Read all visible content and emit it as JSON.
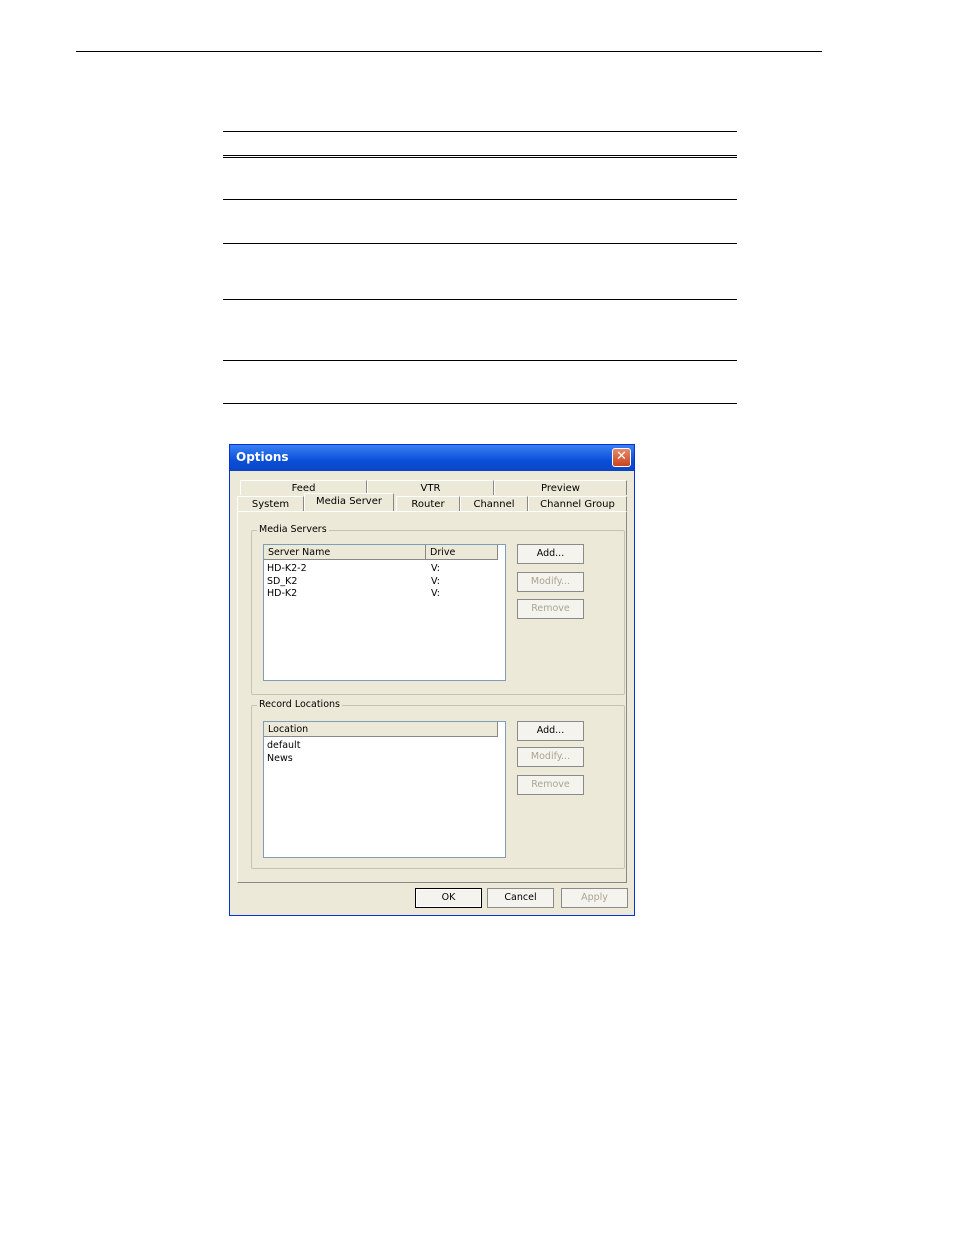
{
  "dialog": {
    "title": "Options",
    "close_glyph": "✕",
    "tabs_row1": [
      "Feed",
      "VTR",
      "Preview"
    ],
    "tabs_row2": [
      "System",
      "Media Server",
      "Router",
      "Channel",
      "Channel Group"
    ],
    "active_tab": "Media Server",
    "media_servers": {
      "label": "Media Servers",
      "columns": [
        "Server Name",
        "Drive"
      ],
      "rows": [
        {
          "name": "HD-K2-2",
          "drive": "V:"
        },
        {
          "name": "SD_K2",
          "drive": "V:"
        },
        {
          "name": "HD-K2",
          "drive": "V:"
        }
      ],
      "add": "Add...",
      "modify": "Modify...",
      "remove": "Remove"
    },
    "record_locations": {
      "label": "Record Locations",
      "columns": [
        "Location"
      ],
      "rows": [
        "default",
        "News"
      ],
      "add": "Add...",
      "modify": "Modify...",
      "remove": "Remove"
    },
    "buttons": {
      "ok": "OK",
      "cancel": "Cancel",
      "apply": "Apply"
    }
  }
}
